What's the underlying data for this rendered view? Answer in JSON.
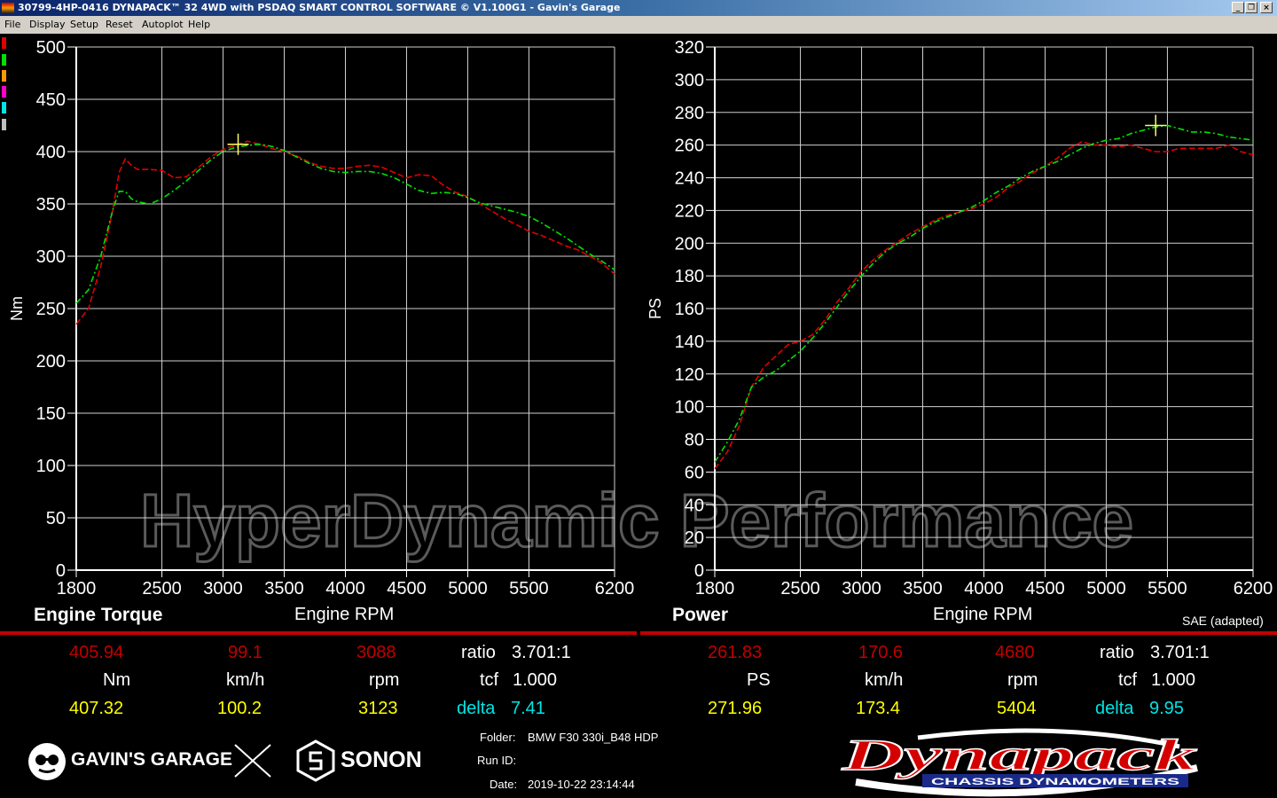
{
  "window": {
    "title": "30799-4HP-0416 DYNAPACK™ 32 4WD with PSDAQ SMART CONTROL SOFTWARE © V1.100G1 - Gavin's Garage",
    "minimize": "_",
    "restore": "❐",
    "close": "×"
  },
  "menu": [
    "File",
    "Display",
    "Setup",
    "Reset",
    "Autoplot",
    "Help"
  ],
  "swatch_colors": [
    "#e00000",
    "#00e000",
    "#ff9900",
    "#ff00cc",
    "#00e5e5",
    "#bfbfbf"
  ],
  "watermark": "HyperDynamic Performance",
  "chart_data": [
    {
      "type": "line",
      "title": "Engine Torque",
      "xlabel": "Engine RPM",
      "ylabel": "Nm",
      "xlim": [
        1800,
        6200
      ],
      "ylim": [
        0,
        500
      ],
      "xticks": [
        1800,
        2500,
        3000,
        3500,
        4000,
        4500,
        5000,
        5500,
        6200
      ],
      "yticks": [
        0,
        50,
        100,
        150,
        200,
        250,
        300,
        350,
        400,
        450,
        500
      ],
      "series": [
        {
          "color": "#e00000",
          "x": [
            1800,
            1900,
            2000,
            2100,
            2150,
            2200,
            2250,
            2300,
            2400,
            2500,
            2600,
            2700,
            2800,
            2900,
            3000,
            3100,
            3200,
            3300,
            3400,
            3500,
            3600,
            3700,
            3800,
            3900,
            4000,
            4100,
            4200,
            4300,
            4400,
            4500,
            4600,
            4700,
            4800,
            4900,
            5000,
            5100,
            5200,
            5300,
            5400,
            5500,
            5600,
            5700,
            5800,
            5900,
            6000,
            6100,
            6200
          ],
          "y": [
            235,
            250,
            290,
            345,
            380,
            393,
            387,
            383,
            383,
            382,
            375,
            376,
            385,
            395,
            402,
            406,
            410,
            407,
            403,
            400,
            396,
            390,
            386,
            384,
            384,
            386,
            387,
            385,
            380,
            375,
            378,
            377,
            368,
            361,
            357,
            350,
            343,
            336,
            330,
            324,
            320,
            315,
            310,
            306,
            300,
            293,
            283
          ]
        },
        {
          "color": "#00e000",
          "x": [
            1800,
            1900,
            2000,
            2100,
            2150,
            2200,
            2250,
            2300,
            2400,
            2500,
            2600,
            2700,
            2800,
            2900,
            3000,
            3100,
            3200,
            3300,
            3400,
            3500,
            3600,
            3700,
            3800,
            3900,
            4000,
            4100,
            4200,
            4300,
            4400,
            4500,
            4600,
            4700,
            4800,
            4900,
            5000,
            5100,
            5200,
            5300,
            5400,
            5500,
            5600,
            5700,
            5800,
            5900,
            6000,
            6100,
            6200
          ],
          "y": [
            255,
            268,
            300,
            345,
            362,
            362,
            355,
            352,
            350,
            355,
            363,
            372,
            382,
            392,
            400,
            404,
            406,
            407,
            405,
            401,
            395,
            389,
            384,
            381,
            380,
            381,
            381,
            379,
            375,
            369,
            363,
            360,
            361,
            360,
            356,
            351,
            348,
            345,
            342,
            338,
            332,
            325,
            318,
            310,
            302,
            295,
            287
          ]
        }
      ],
      "marker": {
        "x": 3123,
        "y": 407
      }
    },
    {
      "type": "line",
      "title": "Power",
      "xlabel": "Engine RPM",
      "ylabel": "PS",
      "xlim": [
        1800,
        6200
      ],
      "ylim": [
        0,
        320
      ],
      "xticks": [
        1800,
        2500,
        3000,
        3500,
        4000,
        4500,
        5000,
        5500,
        6200
      ],
      "yticks": [
        0,
        20,
        40,
        60,
        80,
        100,
        120,
        140,
        160,
        180,
        200,
        220,
        240,
        260,
        280,
        300,
        320
      ],
      "series": [
        {
          "color": "#e00000",
          "x": [
            1800,
            1900,
            2000,
            2100,
            2200,
            2300,
            2400,
            2500,
            2600,
            2700,
            2800,
            2900,
            3000,
            3100,
            3200,
            3300,
            3400,
            3500,
            3600,
            3700,
            3800,
            3900,
            4000,
            4100,
            4200,
            4300,
            4400,
            4500,
            4600,
            4700,
            4800,
            4900,
            5000,
            5100,
            5200,
            5300,
            5400,
            5500,
            5600,
            5700,
            5800,
            5900,
            6000,
            6100,
            6200
          ],
          "y": [
            62,
            72,
            88,
            112,
            124,
            131,
            138,
            140,
            144,
            153,
            164,
            173,
            183,
            190,
            196,
            201,
            206,
            210,
            214,
            217,
            219,
            221,
            224,
            228,
            234,
            238,
            243,
            247,
            252,
            258,
            262,
            260,
            260,
            259,
            260,
            258,
            256,
            256,
            258,
            258,
            258,
            258,
            260,
            256,
            254
          ]
        },
        {
          "color": "#00e000",
          "x": [
            1800,
            1900,
            2000,
            2100,
            2200,
            2300,
            2400,
            2500,
            2600,
            2700,
            2800,
            2900,
            3000,
            3100,
            3200,
            3300,
            3400,
            3500,
            3600,
            3700,
            3800,
            3900,
            4000,
            4100,
            4200,
            4300,
            4400,
            4500,
            4600,
            4700,
            4800,
            4900,
            5000,
            5100,
            5200,
            5300,
            5400,
            5500,
            5600,
            5700,
            5800,
            5900,
            6000,
            6100,
            6200
          ],
          "y": [
            66,
            78,
            92,
            112,
            118,
            122,
            128,
            134,
            142,
            151,
            161,
            171,
            180,
            188,
            195,
            200,
            204,
            209,
            213,
            216,
            219,
            222,
            226,
            231,
            235,
            240,
            244,
            247,
            250,
            254,
            258,
            261,
            263,
            264,
            267,
            269,
            271,
            272,
            270,
            268,
            268,
            267,
            265,
            264,
            263
          ]
        }
      ],
      "marker": {
        "x": 5404,
        "y": 272
      }
    }
  ],
  "torque": {
    "title": "Engine Torque",
    "xlabel": "Engine RPM",
    "ylabel": "Nm",
    "red_value": "405.94",
    "red_speed": "99.1",
    "red_rpm": "3088",
    "unit_value": "Nm",
    "unit_speed": "km/h",
    "unit_rpm": "rpm",
    "yel_value": "407.32",
    "yel_speed": "100.2",
    "yel_rpm": "3123",
    "ratio_label": "ratio",
    "ratio_value": "3.701:1",
    "tcf_label": "tcf",
    "tcf_value": "1.000",
    "delta_label": "delta",
    "delta_value": "7.41"
  },
  "power": {
    "title": "Power",
    "xlabel": "Engine RPM",
    "ylabel": "PS",
    "sae": "SAE (adapted)",
    "red_value": "261.83",
    "red_speed": "170.6",
    "red_rpm": "4680",
    "unit_value": "PS",
    "unit_speed": "km/h",
    "unit_rpm": "rpm",
    "yel_value": "271.96",
    "yel_speed": "173.4",
    "yel_rpm": "5404",
    "ratio_label": "ratio",
    "ratio_value": "3.701:1",
    "tcf_label": "tcf",
    "tcf_value": "1.000",
    "delta_label": "delta",
    "delta_value": "9.95"
  },
  "info": {
    "folder_label": "Folder:",
    "folder_value": "BMW F30 330i_B48 HDP",
    "runid_label": "Run ID:",
    "runid_value": "",
    "date_label": "Date:",
    "date_value": "2019-10-22 23:14:44"
  },
  "logos": {
    "gavins": "GAVIN'S GARAGE",
    "sonon": "SONON",
    "dynapack": "Dynapack",
    "dynapack_sub": "CHASSIS DYNAMOMETERS"
  }
}
